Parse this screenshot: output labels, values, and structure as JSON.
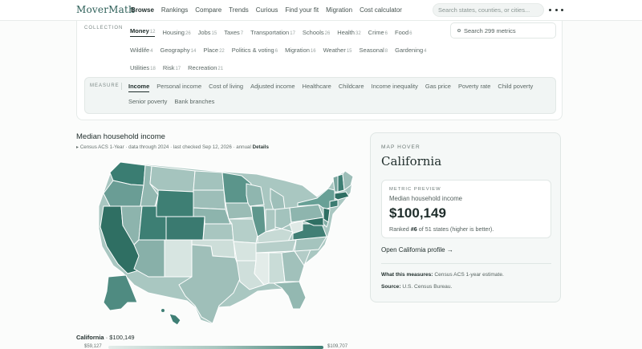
{
  "brand": "MoverMath",
  "nav": [
    "Browse",
    "Rankings",
    "Compare",
    "Trends",
    "Curious",
    "Find your fit",
    "Migration",
    "Cost calculator"
  ],
  "nav_active": "Browse",
  "search": {
    "placeholder": "Search states, counties, or cities..."
  },
  "collection": {
    "label": "COLLECTION",
    "rows": [
      [
        {
          "name": "Money",
          "count": "12",
          "active": true
        },
        {
          "name": "Housing",
          "count": "26"
        },
        {
          "name": "Jobs",
          "count": "15"
        },
        {
          "name": "Taxes",
          "count": "7"
        },
        {
          "name": "Transportation",
          "count": "17"
        },
        {
          "name": "Schools",
          "count": "26"
        },
        {
          "name": "Health",
          "count": "32"
        },
        {
          "name": "Crime",
          "count": "6"
        },
        {
          "name": "Food",
          "count": "6"
        }
      ],
      [
        {
          "name": "Wildlife",
          "count": "4"
        },
        {
          "name": "Geography",
          "count": "14"
        },
        {
          "name": "Place",
          "count": "22"
        },
        {
          "name": "Politics & voting",
          "count": "6"
        },
        {
          "name": "Migration",
          "count": "16"
        },
        {
          "name": "Weather",
          "count": "15"
        },
        {
          "name": "Seasonal",
          "count": "8"
        },
        {
          "name": "Gardening",
          "count": "4"
        }
      ],
      [
        {
          "name": "Utilities",
          "count": "18"
        },
        {
          "name": "Risk",
          "count": "17"
        },
        {
          "name": "Recreation",
          "count": "21"
        }
      ]
    ],
    "metric_search": "Search 299 metrics"
  },
  "measure": {
    "label": "MEASURE",
    "tabs": [
      "Income",
      "Personal income",
      "Cost of living",
      "Adjusted income",
      "Healthcare",
      "Childcare",
      "Income inequality",
      "Gas price",
      "Poverty rate",
      "Child poverty",
      "Senior poverty",
      "Bank branches"
    ],
    "active": "Income"
  },
  "map": {
    "title": "Median household income",
    "source_prefix": "▸ Census ACS 1-Year · data through 2024 · last checked Sep 12, 2026 · annual",
    "details": "Details",
    "legend_state": "California",
    "legend_value": "· $100,149",
    "legend_min": "$59,127",
    "legend_max": "$109,707",
    "color_low": "#e3ece9",
    "color_high": "#2e6e63"
  },
  "hover": {
    "label": "MAP HOVER",
    "state": "California",
    "preview_label": "METRIC PREVIEW",
    "metric": "Median household income",
    "value": "$100,149",
    "rank_prefix": "Ranked",
    "rank": "#6",
    "rank_suffix": "of 51 states (higher is better).",
    "profile_link": "Open California profile →",
    "measures_label": "What this measures:",
    "measures_text": "Census ACS 1-year estimate.",
    "source_label": "Source:",
    "source_text": "U.S. Census Bureau."
  }
}
